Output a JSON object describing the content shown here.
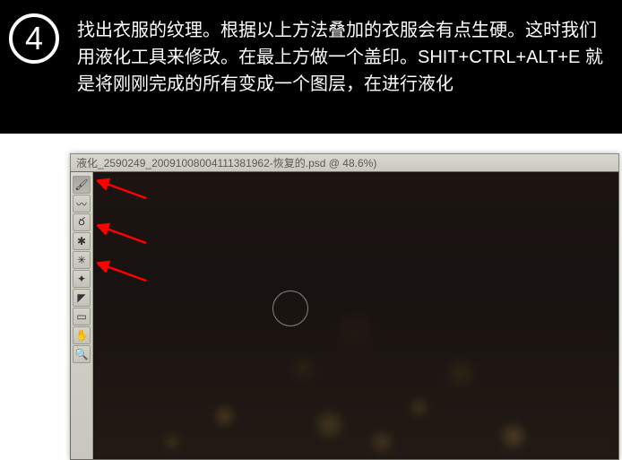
{
  "header": {
    "step_number": "4",
    "instruction": "找出衣服的纹理。根据以上方法叠加的衣服会有点生硬。这时我们用液化工具来修改。在最上方做一个盖印。SHIT+CTRL+ALT+E 就是将刚刚完成的所有变成一个图层，在进行液化"
  },
  "window": {
    "app_name": "液化",
    "title": "_2590249_20091008004111381962-恢复的.psd @ 48.6%)"
  },
  "tools": {
    "t0": "🖌",
    "t1": "〰",
    "t2": "ర",
    "t3": "✱",
    "t4": "✳",
    "t5": "✦",
    "t6": "◤",
    "t7": "▭",
    "t8": "✋",
    "t9": "🔍"
  }
}
